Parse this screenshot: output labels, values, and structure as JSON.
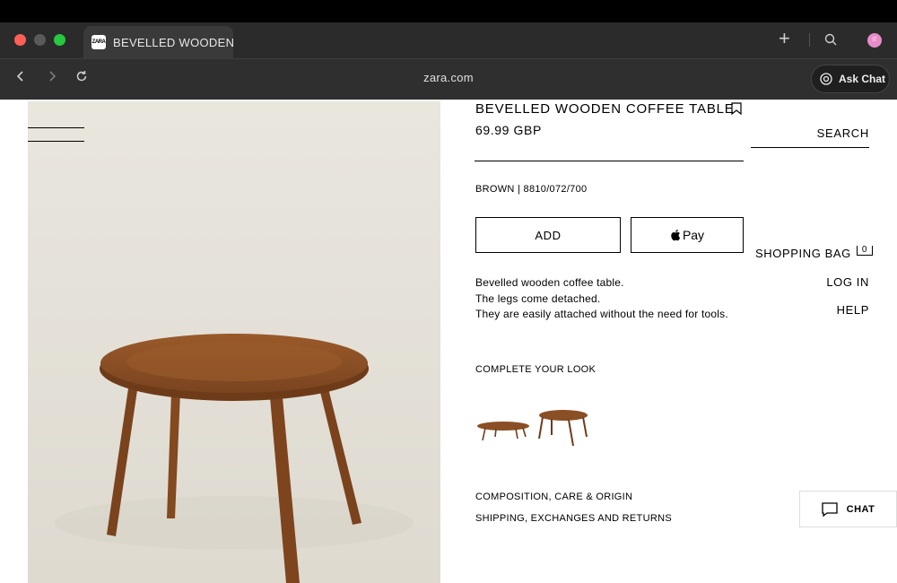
{
  "browser": {
    "tab_title": "BEVELLED WOODEN C",
    "tab_favicon": "ZARA",
    "url": "zara.com",
    "ask_chat_label": "Ask Chat",
    "avatar_initials": "IT"
  },
  "header": {
    "search_label": "SEARCH",
    "shopping_bag_label": "SHOPPING BAG",
    "bag_count": "0",
    "login_label": "LOG IN",
    "help_label": "HELP"
  },
  "product": {
    "title": "BEVELLED WOODEN COFFEE TABLE",
    "price": "69.99 GBP",
    "color_ref": "BROWN | 8810/072/700",
    "add_label": "ADD",
    "pay_label": "Pay",
    "description": [
      "Bevelled wooden coffee table.",
      "The legs come detached.",
      "They are easily attached without the need for tools."
    ]
  },
  "complete_look": {
    "heading": "COMPLETE YOUR LOOK"
  },
  "links": {
    "composition": "COMPOSITION, CARE & ORIGIN",
    "shipping": "SHIPPING, EXCHANGES AND RETURNS"
  },
  "chat": {
    "label": "CHAT"
  },
  "colors": {
    "wood": "#8a4f24",
    "photo_bg": "#e7e4dc",
    "avatar": "#e88cc9"
  }
}
